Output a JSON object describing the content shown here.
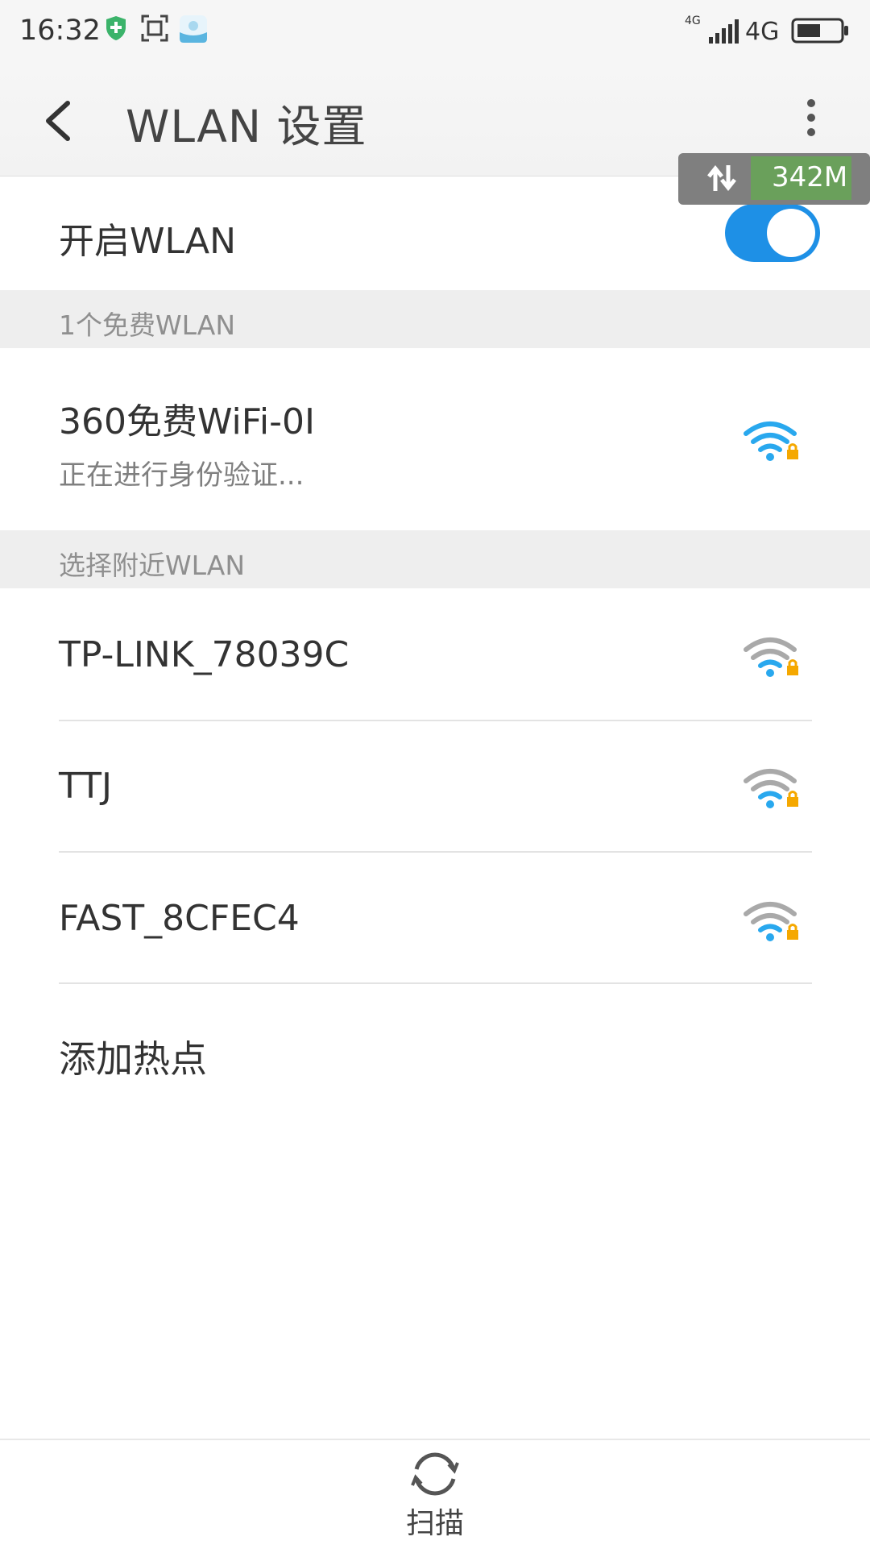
{
  "status_bar": {
    "time": "16:32",
    "network_small": "4G",
    "network": "4G",
    "icons": [
      "shield-plus-icon",
      "screenshot-frame-icon",
      "app-icon",
      "signal-icon",
      "battery-icon"
    ]
  },
  "appbar": {
    "title": "WLAN 设置"
  },
  "traffic_overlay": {
    "value": "342M"
  },
  "wlan_toggle": {
    "label": "开启WLAN",
    "on": true
  },
  "sections": {
    "free": "1个免费WLAN",
    "nearby": "选择附近WLAN"
  },
  "free_networks": [
    {
      "name": "360免费WiFi-0I",
      "status": "正在进行身份验证..."
    }
  ],
  "nearby_networks": [
    {
      "name": "TP-LINK_78039C"
    },
    {
      "name": "TTJ"
    },
    {
      "name": "FAST_8CFEC4"
    }
  ],
  "add_hotspot": "添加热点",
  "bottom": {
    "scan_label": "扫描"
  },
  "colors": {
    "accent": "#1e90e6",
    "wifi_blue": "#29a8ee",
    "lock": "#f5a800"
  }
}
